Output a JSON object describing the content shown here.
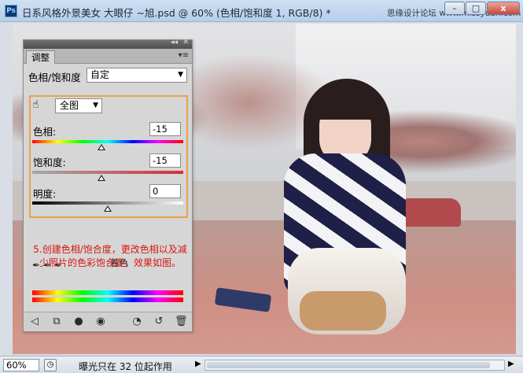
{
  "window": {
    "app_icon": "Ps",
    "title": "日系风格外景美女  大眼仔 ~旭.psd @ 60% (色相/饱和度 1, RGB/8) *",
    "watermark": "思缘设计论坛 www.missyuan.com",
    "controls": {
      "minimize": "–",
      "maximize": "□",
      "close": "x"
    }
  },
  "panel": {
    "tab": "调整",
    "preset_label": "色相/饱和度",
    "preset_value": "自定",
    "channel_value": "全图",
    "sliders": [
      {
        "label": "色相:",
        "value": "-15",
        "position": 0.46
      },
      {
        "label": "饱和度:",
        "value": "-15",
        "position": 0.46
      },
      {
        "label": "明度:",
        "value": "0",
        "position": 0.5
      }
    ],
    "annotation": "5.创建色相/饱合度，更改色相以及减少照片的色彩饱合度，效果如图。",
    "colorize_label": "着色",
    "footer_icons": [
      "back-arrow-icon",
      "expand-view-icon",
      "clip-layer-icon",
      "visibility-icon",
      "view-previous-icon",
      "reset-icon",
      "trash-icon"
    ]
  },
  "statusbar": {
    "zoom": "60%",
    "message": "曝光只在 32 位起作用"
  }
}
